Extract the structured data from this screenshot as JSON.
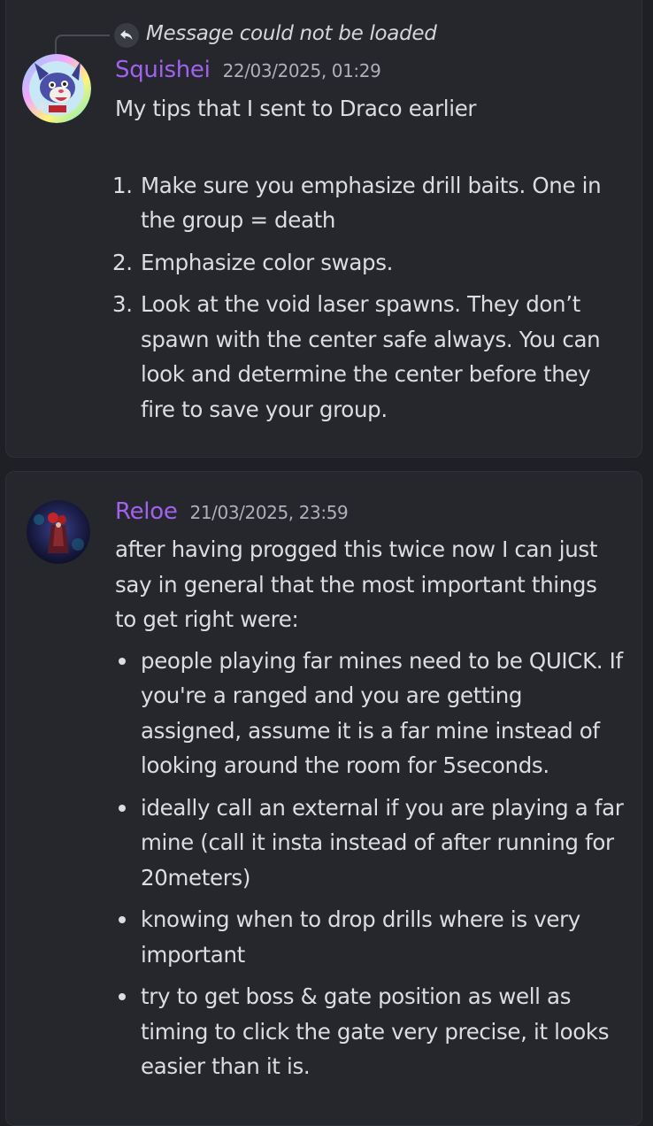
{
  "messages": [
    {
      "reply_preview": "Message could not be loaded",
      "username": "Squishei",
      "timestamp": "22/03/2025, 01:29",
      "intro": "My tips that I sent to Draco earlier",
      "list": [
        {
          "num": "1.",
          "text": "Make sure you emphasize drill baits. One in the group = death"
        },
        {
          "num": "2.",
          "text": "Emphasize color swaps."
        },
        {
          "num": "3.",
          "text": "Look at the void laser spawns. They don’t spawn with the center safe always. You can look and determine the center before they fire to save your group."
        }
      ]
    },
    {
      "username": "Reloe",
      "timestamp": "21/03/2025, 23:59",
      "intro": "after having progged this twice now I can just say in general that the most important things to get right were:",
      "list": [
        {
          "text": "people playing far mines need to be QUICK. If you're a ranged and you are getting assigned, assume it is a far mine instead of looking around the room for 5seconds."
        },
        {
          "text": "ideally call an external if you are playing a far mine (call it insta instead of after running for 20meters)"
        },
        {
          "text": "knowing when to drop drills where is very important"
        },
        {
          "text": "try to get boss & gate position as well as timing to click the gate very precise, it looks easier than it is."
        }
      ]
    }
  ],
  "colors": {
    "background": "#1f2025",
    "card": "#25272d",
    "username": "#a361f0",
    "text": "#dcdde1",
    "timestamp": "#aeb1b8"
  },
  "icons": {
    "reply": "reply-arrow-icon"
  }
}
